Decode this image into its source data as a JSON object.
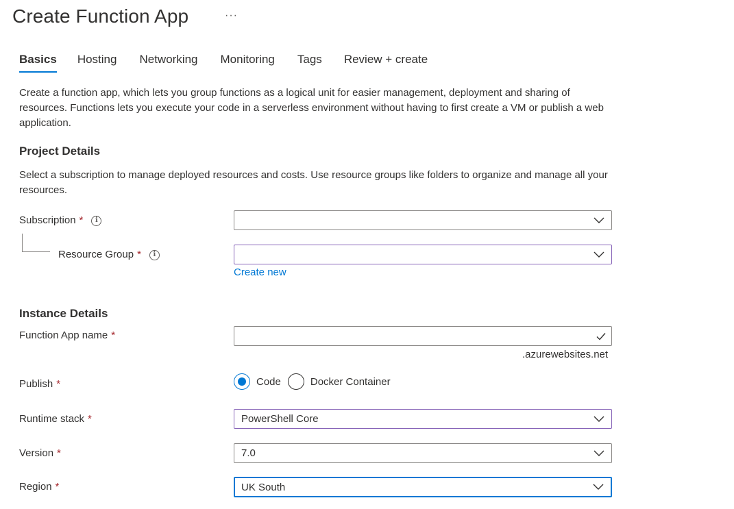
{
  "header": {
    "title": "Create Function App",
    "more": "···"
  },
  "tabs": [
    {
      "label": "Basics",
      "active": true
    },
    {
      "label": "Hosting"
    },
    {
      "label": "Networking"
    },
    {
      "label": "Monitoring"
    },
    {
      "label": "Tags"
    },
    {
      "label": "Review + create"
    }
  ],
  "intro": "Create a function app, which lets you group functions as a logical unit for easier management, deployment and sharing of resources. Functions lets you execute your code in a serverless environment without having to first create a VM or publish a web application.",
  "project": {
    "heading": "Project Details",
    "description": "Select a subscription to manage deployed resources and costs. Use resource groups like folders to organize and manage all your resources.",
    "subscription": {
      "label": "Subscription",
      "value": ""
    },
    "resource_group": {
      "label": "Resource Group",
      "value": "",
      "create_new": "Create new"
    }
  },
  "instance": {
    "heading": "Instance Details",
    "function_app_name": {
      "label": "Function App name",
      "value": "",
      "suffix": ".azurewebsites.net"
    },
    "publish": {
      "label": "Publish",
      "options": [
        "Code",
        "Docker Container"
      ],
      "selected": "Code"
    },
    "runtime_stack": {
      "label": "Runtime stack",
      "value": "PowerShell Core"
    },
    "version": {
      "label": "Version",
      "value": "7.0"
    },
    "region": {
      "label": "Region",
      "value": "UK South"
    }
  },
  "required_mark": "*",
  "info_glyph": "i",
  "colors": {
    "accent": "#0078d4",
    "required": "#a4262c",
    "invalid_border": "#8764b8"
  },
  "icons": {
    "dropdown": "chevron-down-icon",
    "valid": "checkmark-icon",
    "info": "info-icon"
  }
}
